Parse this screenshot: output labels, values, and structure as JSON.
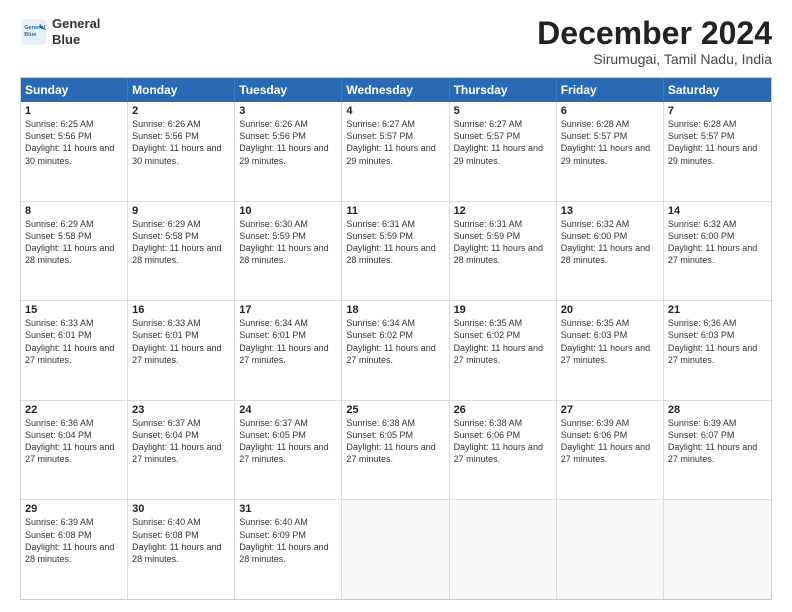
{
  "logo": {
    "line1": "General",
    "line2": "Blue"
  },
  "title": "December 2024",
  "subtitle": "Sirumugai, Tamil Nadu, India",
  "header_days": [
    "Sunday",
    "Monday",
    "Tuesday",
    "Wednesday",
    "Thursday",
    "Friday",
    "Saturday"
  ],
  "rows": [
    [
      {
        "day": "1",
        "sunrise": "Sunrise: 6:25 AM",
        "sunset": "Sunset: 5:56 PM",
        "daylight": "Daylight: 11 hours and 30 minutes."
      },
      {
        "day": "2",
        "sunrise": "Sunrise: 6:26 AM",
        "sunset": "Sunset: 5:56 PM",
        "daylight": "Daylight: 11 hours and 30 minutes."
      },
      {
        "day": "3",
        "sunrise": "Sunrise: 6:26 AM",
        "sunset": "Sunset: 5:56 PM",
        "daylight": "Daylight: 11 hours and 29 minutes."
      },
      {
        "day": "4",
        "sunrise": "Sunrise: 6:27 AM",
        "sunset": "Sunset: 5:57 PM",
        "daylight": "Daylight: 11 hours and 29 minutes."
      },
      {
        "day": "5",
        "sunrise": "Sunrise: 6:27 AM",
        "sunset": "Sunset: 5:57 PM",
        "daylight": "Daylight: 11 hours and 29 minutes."
      },
      {
        "day": "6",
        "sunrise": "Sunrise: 6:28 AM",
        "sunset": "Sunset: 5:57 PM",
        "daylight": "Daylight: 11 hours and 29 minutes."
      },
      {
        "day": "7",
        "sunrise": "Sunrise: 6:28 AM",
        "sunset": "Sunset: 5:57 PM",
        "daylight": "Daylight: 11 hours and 29 minutes."
      }
    ],
    [
      {
        "day": "8",
        "sunrise": "Sunrise: 6:29 AM",
        "sunset": "Sunset: 5:58 PM",
        "daylight": "Daylight: 11 hours and 28 minutes."
      },
      {
        "day": "9",
        "sunrise": "Sunrise: 6:29 AM",
        "sunset": "Sunset: 5:58 PM",
        "daylight": "Daylight: 11 hours and 28 minutes."
      },
      {
        "day": "10",
        "sunrise": "Sunrise: 6:30 AM",
        "sunset": "Sunset: 5:59 PM",
        "daylight": "Daylight: 11 hours and 28 minutes."
      },
      {
        "day": "11",
        "sunrise": "Sunrise: 6:31 AM",
        "sunset": "Sunset: 5:59 PM",
        "daylight": "Daylight: 11 hours and 28 minutes."
      },
      {
        "day": "12",
        "sunrise": "Sunrise: 6:31 AM",
        "sunset": "Sunset: 5:59 PM",
        "daylight": "Daylight: 11 hours and 28 minutes."
      },
      {
        "day": "13",
        "sunrise": "Sunrise: 6:32 AM",
        "sunset": "Sunset: 6:00 PM",
        "daylight": "Daylight: 11 hours and 28 minutes."
      },
      {
        "day": "14",
        "sunrise": "Sunrise: 6:32 AM",
        "sunset": "Sunset: 6:00 PM",
        "daylight": "Daylight: 11 hours and 27 minutes."
      }
    ],
    [
      {
        "day": "15",
        "sunrise": "Sunrise: 6:33 AM",
        "sunset": "Sunset: 6:01 PM",
        "daylight": "Daylight: 11 hours and 27 minutes."
      },
      {
        "day": "16",
        "sunrise": "Sunrise: 6:33 AM",
        "sunset": "Sunset: 6:01 PM",
        "daylight": "Daylight: 11 hours and 27 minutes."
      },
      {
        "day": "17",
        "sunrise": "Sunrise: 6:34 AM",
        "sunset": "Sunset: 6:01 PM",
        "daylight": "Daylight: 11 hours and 27 minutes."
      },
      {
        "day": "18",
        "sunrise": "Sunrise: 6:34 AM",
        "sunset": "Sunset: 6:02 PM",
        "daylight": "Daylight: 11 hours and 27 minutes."
      },
      {
        "day": "19",
        "sunrise": "Sunrise: 6:35 AM",
        "sunset": "Sunset: 6:02 PM",
        "daylight": "Daylight: 11 hours and 27 minutes."
      },
      {
        "day": "20",
        "sunrise": "Sunrise: 6:35 AM",
        "sunset": "Sunset: 6:03 PM",
        "daylight": "Daylight: 11 hours and 27 minutes."
      },
      {
        "day": "21",
        "sunrise": "Sunrise: 6:36 AM",
        "sunset": "Sunset: 6:03 PM",
        "daylight": "Daylight: 11 hours and 27 minutes."
      }
    ],
    [
      {
        "day": "22",
        "sunrise": "Sunrise: 6:36 AM",
        "sunset": "Sunset: 6:04 PM",
        "daylight": "Daylight: 11 hours and 27 minutes."
      },
      {
        "day": "23",
        "sunrise": "Sunrise: 6:37 AM",
        "sunset": "Sunset: 6:04 PM",
        "daylight": "Daylight: 11 hours and 27 minutes."
      },
      {
        "day": "24",
        "sunrise": "Sunrise: 6:37 AM",
        "sunset": "Sunset: 6:05 PM",
        "daylight": "Daylight: 11 hours and 27 minutes."
      },
      {
        "day": "25",
        "sunrise": "Sunrise: 6:38 AM",
        "sunset": "Sunset: 6:05 PM",
        "daylight": "Daylight: 11 hours and 27 minutes."
      },
      {
        "day": "26",
        "sunrise": "Sunrise: 6:38 AM",
        "sunset": "Sunset: 6:06 PM",
        "daylight": "Daylight: 11 hours and 27 minutes."
      },
      {
        "day": "27",
        "sunrise": "Sunrise: 6:39 AM",
        "sunset": "Sunset: 6:06 PM",
        "daylight": "Daylight: 11 hours and 27 minutes."
      },
      {
        "day": "28",
        "sunrise": "Sunrise: 6:39 AM",
        "sunset": "Sunset: 6:07 PM",
        "daylight": "Daylight: 11 hours and 27 minutes."
      }
    ],
    [
      {
        "day": "29",
        "sunrise": "Sunrise: 6:39 AM",
        "sunset": "Sunset: 6:08 PM",
        "daylight": "Daylight: 11 hours and 28 minutes."
      },
      {
        "day": "30",
        "sunrise": "Sunrise: 6:40 AM",
        "sunset": "Sunset: 6:08 PM",
        "daylight": "Daylight: 11 hours and 28 minutes."
      },
      {
        "day": "31",
        "sunrise": "Sunrise: 6:40 AM",
        "sunset": "Sunset: 6:09 PM",
        "daylight": "Daylight: 11 hours and 28 minutes."
      },
      null,
      null,
      null,
      null
    ]
  ]
}
